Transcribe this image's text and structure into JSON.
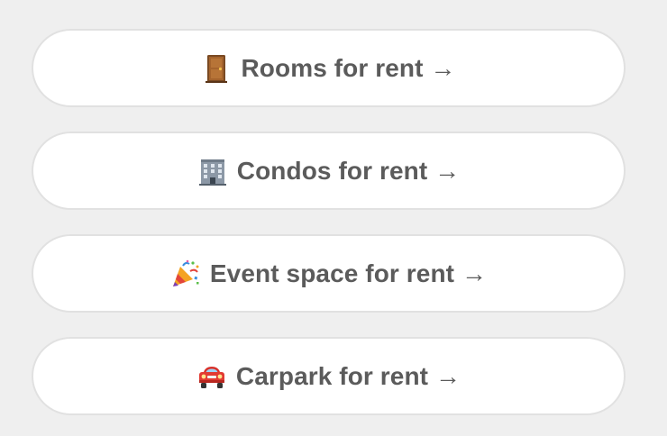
{
  "rental_options": [
    {
      "icon": "door-icon",
      "label": "Rooms for rent →"
    },
    {
      "icon": "office-building-icon",
      "label": "Condos for rent →"
    },
    {
      "icon": "party-popper-icon",
      "label": "Event space for rent →"
    },
    {
      "icon": "car-icon",
      "label": "Carpark for rent →"
    }
  ],
  "colors": {
    "page_background": "#efefef",
    "button_background": "#ffffff",
    "button_border": "#e1e1e1",
    "button_text": "#5b5b5b"
  }
}
